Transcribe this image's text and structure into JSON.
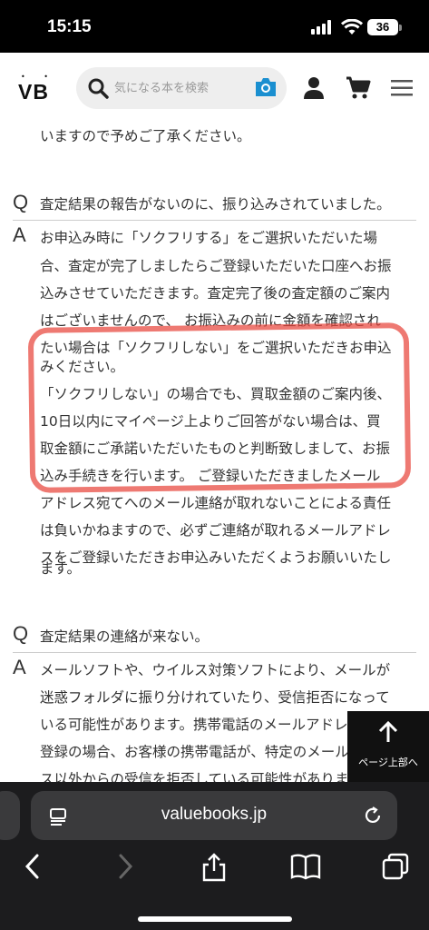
{
  "status": {
    "time": "15:15",
    "battery": "36"
  },
  "header": {
    "logo_dots": "• •",
    "logo": "VB",
    "search_placeholder": "気になる本を検索"
  },
  "content": {
    "intro_tail": "いますので予めご了承ください。",
    "faq": [
      {
        "q_mark": "Q",
        "question": "査定結果の報告がないのに、振り込みされていました。",
        "a_mark": "A",
        "answer_lines": [
          "お申込み時に「ソクフリする」をご選択いただいた場",
          "合、査定が完了しましたらご登録いただいた口座へお振",
          "込みさせていただきます。査定完了後の査定額のご案内",
          "はございませんので、 お振込みの前に金額を確認され",
          "たい場合は「ソクフリしない」をご選択いただきお申込",
          "みください。",
          "「ソクフリしない」の場合でも、買取金額のご案内後、",
          "10日以内にマイページ上よりご回答がない場合は、買",
          "取金額にご承諾いただいたものと判断致しまして、お振",
          "込み手続きを行います。 ご登録いただきましたメール",
          "アドレス宛てへのメール連絡が取れないことによる責任",
          "は負いかねますので、必ずご連絡が取れるメールアドレ",
          "スをご登録いただきお申込みいただくようお願いいたし",
          "ます。"
        ]
      },
      {
        "q_mark": "Q",
        "question": "査定結果の連絡が来ない。",
        "a_mark": "A",
        "answer_lines": [
          "メールソフトや、ウイルス対策ソフトにより、メールが",
          "迷惑フォルダに振り分けれていたり、受信拒否になって",
          "いる可能性があります。携帯電話のメールアドレスでご",
          "登録の場合、お客様の携帯電話が、特定のメールアドレ",
          "ス以外からの受信を拒否している可能性があります。"
        ]
      }
    ]
  },
  "back_to_top": {
    "label": "ページ上部へ"
  },
  "browser": {
    "url": "valuebooks.jp"
  },
  "colors": {
    "accent": "#1a8fd0",
    "highlight": "#e8453c"
  }
}
